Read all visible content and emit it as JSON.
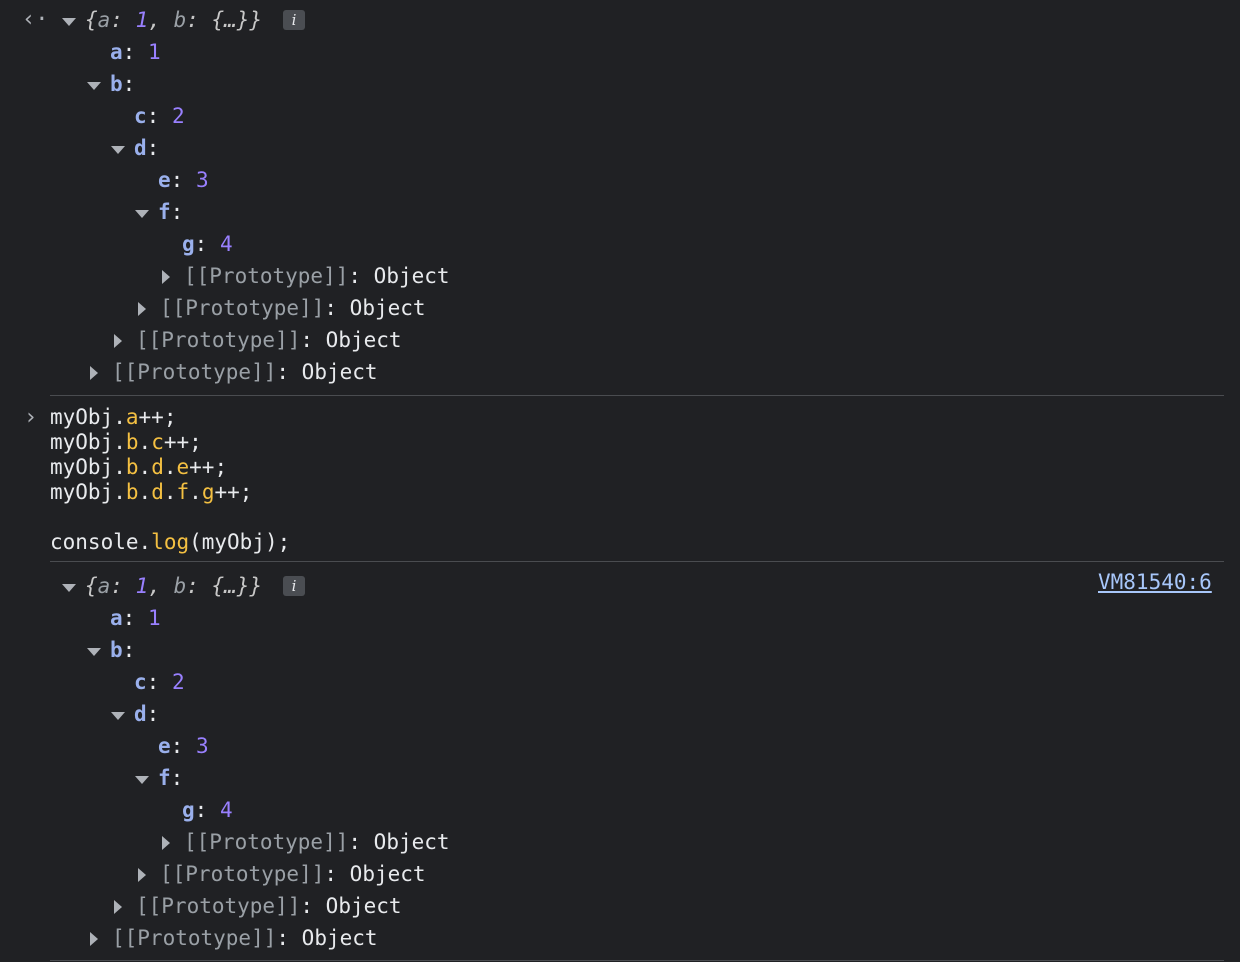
{
  "output1": {
    "prompt_icon": "return-arrow-icon",
    "preview": {
      "open": "{",
      "a_key": "a",
      "sep": ": ",
      "a_val": "1",
      "comma": ", ",
      "b_key": "b",
      "b_val": "{…}",
      "close": "}"
    },
    "info_label": "i",
    "rows": {
      "a_key": "a",
      "a_val": "1",
      "b_key": "b",
      "c_key": "c",
      "c_val": "2",
      "d_key": "d",
      "e_key": "e",
      "e_val": "3",
      "f_key": "f",
      "g_key": "g",
      "g_val": "4"
    },
    "proto_key": "[[Prototype]]",
    "proto_val": "Object"
  },
  "input": {
    "prompt_icon": "chevron-right-icon",
    "lines": [
      "myObj.a++;",
      "myObj.b.c++;",
      "myObj.b.d.e++;",
      "myObj.b.d.f.g++;",
      "",
      "console.log(myObj);"
    ],
    "tokens": {
      "obj": "myObj",
      "dot": ".",
      "a": "a",
      "b": "b",
      "c": "c",
      "d": "d",
      "e": "e",
      "f": "f",
      "g": "g",
      "inc": "++;",
      "console": "console",
      "log": "log",
      "call": "(myObj);"
    }
  },
  "output2": {
    "source_link": "VM81540:6",
    "preview": {
      "open": "{",
      "a_key": "a",
      "sep": ": ",
      "a_val": "1",
      "comma": ", ",
      "b_key": "b",
      "b_val": "{…}",
      "close": "}"
    },
    "info_label": "i",
    "rows": {
      "a_key": "a",
      "a_val": "1",
      "b_key": "b",
      "c_key": "c",
      "c_val": "2",
      "d_key": "d",
      "e_key": "e",
      "e_val": "3",
      "f_key": "f",
      "g_key": "g",
      "g_val": "4"
    },
    "proto_key": "[[Prototype]]",
    "proto_val": "Object"
  },
  "colors": {
    "background": "#202124",
    "key": "#9ab0ec",
    "number": "#9980ff",
    "property": "#f4c042",
    "link": "#a8c7fa"
  }
}
